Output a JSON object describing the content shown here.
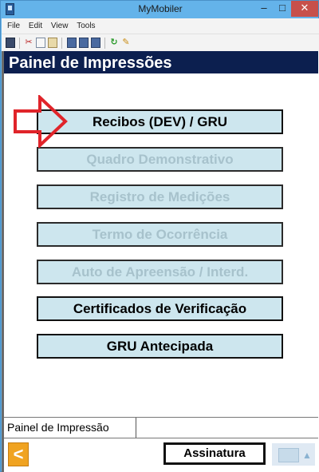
{
  "window": {
    "title": "MyMobiler"
  },
  "menu": {
    "items": [
      "File",
      "Edit",
      "View",
      "Tools"
    ]
  },
  "header": {
    "title": "Painel de Impressões"
  },
  "buttons": [
    {
      "label": "Recibos (DEV) / GRU",
      "enabled": true
    },
    {
      "label": "Quadro Demonstrativo",
      "enabled": false
    },
    {
      "label": "Registro de Medições",
      "enabled": false
    },
    {
      "label": "Termo de Ocorrência",
      "enabled": false
    },
    {
      "label": "Auto de Apreensão / Interd.",
      "enabled": false
    },
    {
      "label": "Certificados de Verificação",
      "enabled": true
    },
    {
      "label": "GRU Antecipada",
      "enabled": true
    }
  ],
  "status": {
    "label": "Painel de Impressão",
    "value": ""
  },
  "bottom": {
    "back_label": "<",
    "sign_label": "Assinatura"
  },
  "colors": {
    "header_bg": "#0c1f4f",
    "button_bg": "#cde6ee",
    "disabled_text": "#a7c2cc",
    "arrow": "#e0242a",
    "back_btn": "#f0a321"
  }
}
